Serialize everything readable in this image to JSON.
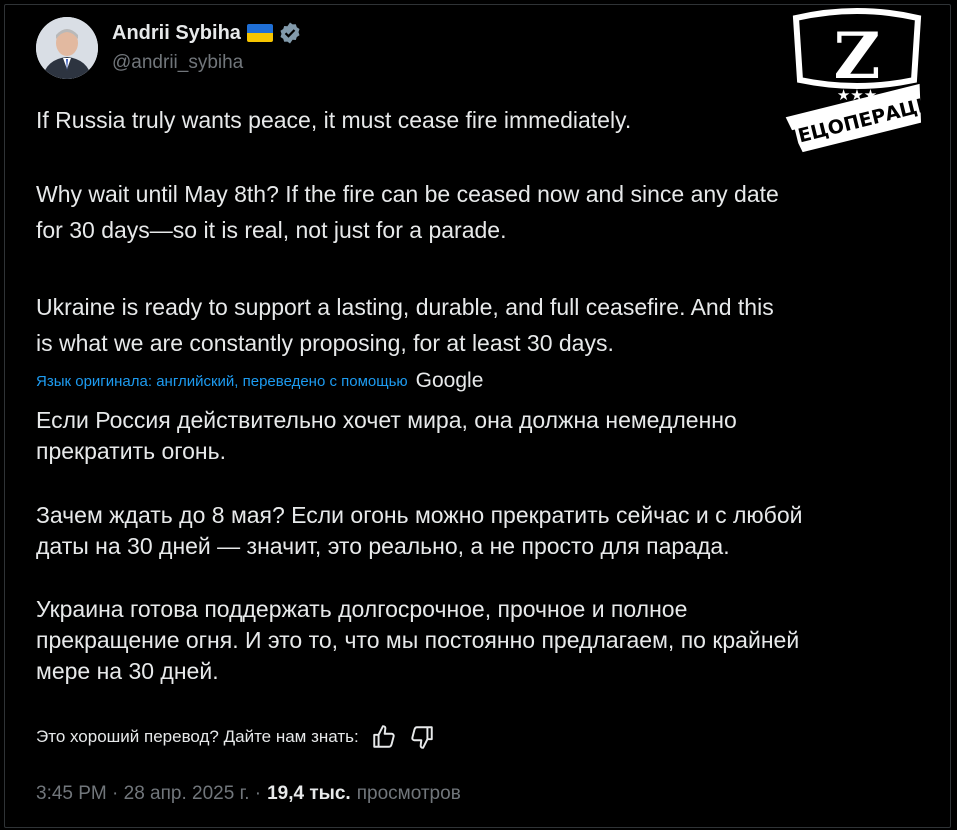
{
  "author": {
    "name": "Andrii Sybiha",
    "handle": "@andrii_sybiha",
    "flag_colors": [
      "#1f6fd6",
      "#f6c500"
    ],
    "verified_icon": "verified-badge-icon"
  },
  "logo": {
    "letter": "Z",
    "stars": "★★★",
    "caption": "СПЕЦОПЕРАЦИЯ"
  },
  "original": {
    "p1": "If Russia truly wants peace, it must cease fire immediately.",
    "p2": "Why wait until May 8th? If the fire can be ceased now and since any date\nfor 30 days—so it is real, not just for a parade.",
    "p3": "Ukraine is ready to support a lasting, durable, and full ceasefire. And this\nis what we are constantly proposing, for at least 30 days."
  },
  "translation_note": {
    "text": "Язык оригинала: английский, переведено с помощью",
    "provider": "Google"
  },
  "translated": {
    "p1": "Если Россия действительно хочет мира, она должна немедленно\nпрекратить огонь.",
    "p2": "Зачем ждать до 8 мая? Если огонь можно прекратить сейчас и с любой\nдаты на 30 дней — значит, это реально, а не просто для парада.",
    "p3": "Украина готова поддержать долгосрочное, прочное и полное\nпрекращение огня. И это то, что мы постоянно предлагаем, по крайней\nмере на 30 дней."
  },
  "feedback": {
    "prompt": "Это хороший перевод? Дайте нам знать:"
  },
  "meta": {
    "timestamp": "3:45 PM · 28 апр. 2025 г. ·",
    "views_count": "19,4 тыс.",
    "views_label": "просмотров"
  },
  "colors": {
    "background": "#000000",
    "text": "#e7e9ea",
    "muted": "#71767b",
    "accent": "#1d9bf0"
  }
}
